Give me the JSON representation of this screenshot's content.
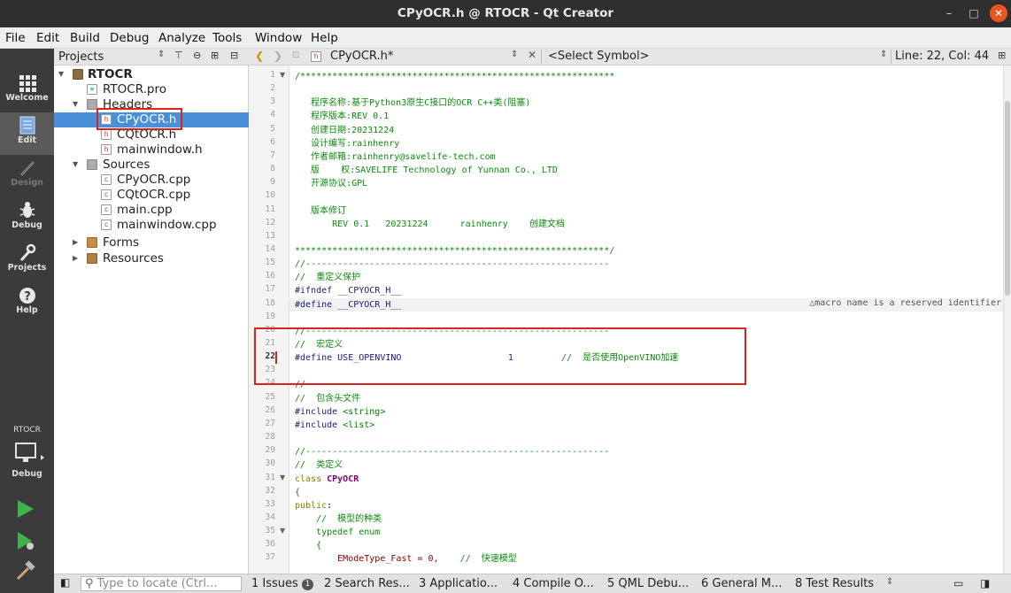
{
  "window": {
    "title": "CPyOCR.h @ RTOCR - Qt Creator"
  },
  "menu": [
    "File",
    "Edit",
    "Build",
    "Debug",
    "Analyze",
    "Tools",
    "Window",
    "Help"
  ],
  "modes": [
    {
      "label": "Welcome",
      "icon": "grid-icon"
    },
    {
      "label": "Edit",
      "icon": "document-icon"
    },
    {
      "label": "Design",
      "icon": "pencil-icon"
    },
    {
      "label": "Debug",
      "icon": "bug-icon"
    },
    {
      "label": "Projects",
      "icon": "wrench-icon"
    },
    {
      "label": "Help",
      "icon": "help-icon"
    }
  ],
  "kit": {
    "project": "RTOCR",
    "config": "Debug"
  },
  "projects_pane": {
    "title": "Projects"
  },
  "tree": [
    {
      "label": "RTOCR",
      "level": 0,
      "bold": true
    },
    {
      "label": "RTOCR.pro",
      "level": 2
    },
    {
      "label": "Headers",
      "level": 1
    },
    {
      "label": "CPyOCR.h",
      "level": 2,
      "selected": true
    },
    {
      "label": "CQtOCR.h",
      "level": 2
    },
    {
      "label": "mainwindow.h",
      "level": 2
    },
    {
      "label": "Sources",
      "level": 1
    },
    {
      "label": "CPyOCR.cpp",
      "level": 2
    },
    {
      "label": "CQtOCR.cpp",
      "level": 2
    },
    {
      "label": "main.cpp",
      "level": 2
    },
    {
      "label": "mainwindow.cpp",
      "level": 2
    },
    {
      "label": "Forms",
      "level": 1
    },
    {
      "label": "Resources",
      "level": 1
    }
  ],
  "editor": {
    "filename": "CPyOCR.h*",
    "symbol": "<Select Symbol>",
    "position": "Line: 22, Col: 44",
    "warning": "macro name is a reserved identifier",
    "lines": [
      "/***********************************************************",
      "",
      "   程序名称:基于Python3原生C接口的OCR C++类(阻塞)",
      "   程序版本:REV 0.1",
      "   创建日期:20231224",
      "   设计编写:rainhenry",
      "   作者邮箱:rainhenry@savelife-tech.com",
      "   版    权:SAVELIFE Technology of Yunnan Co., LTD",
      "   开源协议:GPL",
      "",
      "   版本修订",
      "       REV 0.1   20231224      rainhenry    创建文档",
      "",
      "***********************************************************/",
      "//---------------------------------------------------------",
      "//  重定义保护",
      "#ifndef __CPYOCR_H__",
      "#define __CPYOCR_H__",
      "",
      "//---------------------------------------------------------",
      "//  宏定义",
      "#define USE_OPENVINO                    1         //  是否使用OpenVINO加速",
      "",
      "//---------------------------------------------------------",
      "//  包含头文件",
      "#include <string>",
      "#include <list>",
      "",
      "//---------------------------------------------------------",
      "//  类定义",
      "class CPyOCR",
      "{",
      "public:",
      "    //  模型的种类",
      "    typedef enum",
      "    {",
      "        EModeType_Fast = 0,    //  快速模型"
    ]
  },
  "status": {
    "locate_placeholder": "Type to locate (Ctrl...",
    "issues": "1 Issues",
    "issues_count": "1",
    "tabs": [
      "2 Search Res...",
      "3 Applicatio...",
      "4 Compile O...",
      "5 QML Debu...",
      "6 General M...",
      "8 Test Results"
    ]
  }
}
